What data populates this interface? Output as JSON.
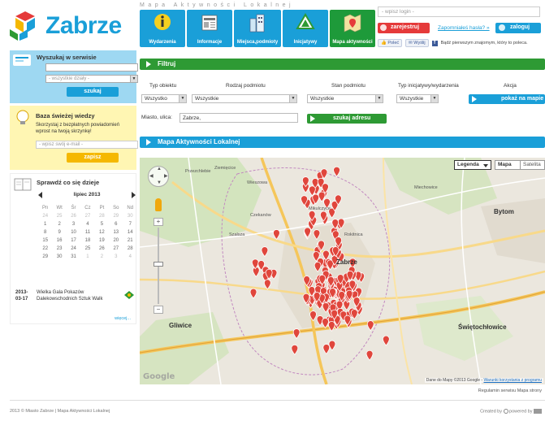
{
  "header": {
    "logo_text": "Zabrze",
    "tagline": "Mapa Aktywności Lokalnej",
    "nav": [
      {
        "label": "Wydarzenia",
        "icon": "info-person-icon"
      },
      {
        "label": "Informacje",
        "icon": "newspaper-icon"
      },
      {
        "label": "Miejsca,podmioty",
        "icon": "buildings-icon"
      },
      {
        "label": "Inicjatywy",
        "icon": "recycle-icon"
      },
      {
        "label": "Mapa aktywności",
        "icon": "map-icon"
      }
    ],
    "login_placeholder": "- wpisz login -",
    "register_label": "zarejestruj",
    "forgot_label": "Zapomniałeś hasła? »",
    "login_label": "zaloguj",
    "like_label": "Poleć",
    "send_label": "Wyślij",
    "fb_text": "Bądź pierwszym znajomym, który to poleca."
  },
  "sidebar": {
    "search": {
      "title": "Wyszukaj w serwisie",
      "select_value": "- wszystkie działy -",
      "button": "szukaj"
    },
    "news": {
      "title": "Baza świeżej wiedzy",
      "description": "Skorzystaj z bezpłatnych powiadomień wprost na twoją skrzynkę!",
      "email_placeholder": "- wpisz swój e-mail -",
      "button": "zapisz"
    },
    "events": {
      "title": "Sprawdź co się dzieje",
      "month": "lipiec 2013",
      "weekdays": [
        "Pn",
        "Wt",
        "Śr",
        "Cz",
        "Pt",
        "So",
        "Nd"
      ],
      "weeks": [
        [
          "24",
          "25",
          "26",
          "27",
          "28",
          "29",
          "30"
        ],
        [
          "1",
          "2",
          "3",
          "4",
          "5",
          "6",
          "7"
        ],
        [
          "8",
          "9",
          "10",
          "11",
          "12",
          "13",
          "14"
        ],
        [
          "15",
          "16",
          "17",
          "18",
          "19",
          "20",
          "21"
        ],
        [
          "22",
          "23",
          "24",
          "25",
          "26",
          "27",
          "28"
        ],
        [
          "29",
          "30",
          "31",
          "1",
          "2",
          "3",
          "4"
        ]
      ],
      "event_date": "2013-03-17",
      "event_name": "Wielka Gala Pokazów Dalekowschodnich Sztuk Walk",
      "more_label": "więcej..."
    }
  },
  "filter": {
    "title": "Filtruj",
    "labels": {
      "object_type": "Typ obiektu",
      "entity_kind": "Rodzaj podmiotu",
      "entity_state": "Stan podmiotu",
      "initiative_type": "Typ inicjatywy/wydarzenia",
      "action": "Akcja"
    },
    "values": {
      "object_type": "Wszystko",
      "entity_kind": "Wszystkie",
      "entity_state": "Wszystkie",
      "initiative_type": "Wszystkie"
    },
    "show_on_map": "pokaż na mapie",
    "city_label": "Miasto, ulica:",
    "city_value": "Zabrze,",
    "search_address": "szukaj adresu"
  },
  "map": {
    "title": "Mapa Aktywności Lokalnej",
    "legend_label": "Legenda",
    "map_type_map": "Mapa",
    "map_type_satellite": "Satelita",
    "google": "Google",
    "attribution": "Dane do Mapy ©2013 Google -",
    "terms": "Warunki korzystania z programu",
    "places": [
      "Przezchlebie",
      "Ziemięcice",
      "Wieszowa",
      "Czekanów",
      "Szałsza",
      "Mikulczyce",
      "Rokitnica",
      "Bytom",
      "Gliwice",
      "Świętochłowice",
      "Miechowice",
      "Zabrze"
    ]
  },
  "footer": {
    "below_map": "Regulamin serwisu   Mapa strony",
    "copyright": "2013 © Miasto Zabrze | Mapa Aktywności Lokalnej",
    "created_by": "Created by",
    "powered_by": "powered by"
  },
  "colors": {
    "brand_blue": "#1a9fd8",
    "brand_green": "#2e9a34",
    "alert_red": "#e53a3a",
    "accent_yellow": "#f5b800",
    "marker_red": "#e0463c"
  }
}
